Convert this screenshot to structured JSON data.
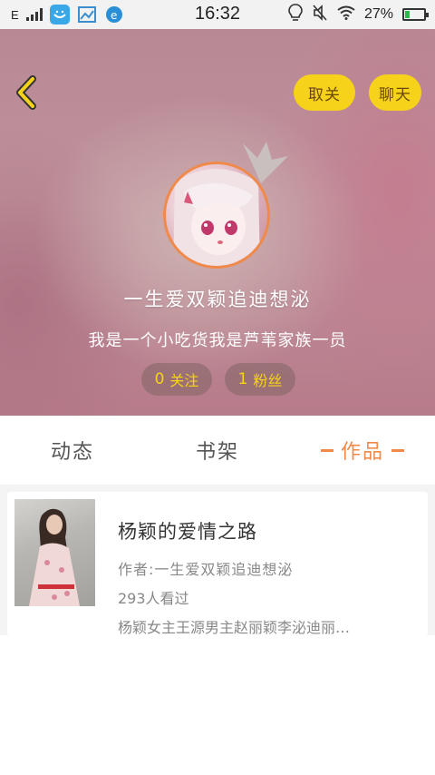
{
  "status_bar": {
    "network": "E",
    "time": "16:32",
    "battery_text": "27%",
    "battery_level": 0.27
  },
  "header": {
    "unfollow_label": "取关",
    "chat_label": "聊天",
    "nickname": "一生爱双颖追迪想泌",
    "signature": "我是一个小吃货我是芦苇家族一员",
    "following_count": "0",
    "following_label": "关注",
    "fans_count": "1",
    "fans_label": "粉丝"
  },
  "tabs": [
    {
      "label": "动态"
    },
    {
      "label": "书架"
    },
    {
      "label": "作品",
      "active": true
    }
  ],
  "works": [
    {
      "title": "杨颖的爱情之路",
      "author": "作者:一生爱双颖追迪想泌",
      "views": "293人看过",
      "description": "杨颖女主王源男主赵丽颖李泌迪丽…"
    }
  ],
  "colors": {
    "accent_orange": "#f08a4b",
    "button_yellow": "#f7d21a"
  },
  "icons": {
    "back": "chevron-left-icon",
    "crown": "crown-icon"
  }
}
